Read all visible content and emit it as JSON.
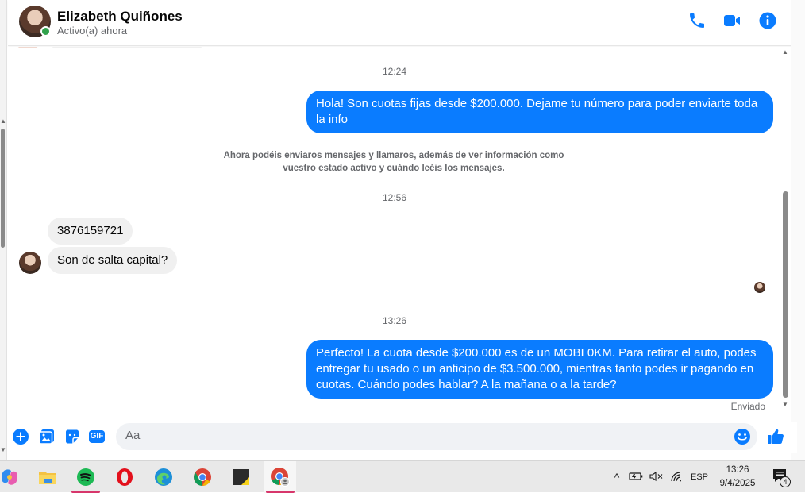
{
  "header": {
    "contact_name": "Elizabeth Quiñones",
    "status": "Activo(a) ahora",
    "actions": [
      "phone-icon",
      "video-icon",
      "info-icon"
    ],
    "accent_color": "#0a7cff"
  },
  "messages": {
    "time_1": "12:24",
    "out_1": "Hola! Son cuotas fijas desde $200.000. Dejame tu número para poder enviarte toda la info",
    "notice_line1": "Ahora podéis enviaros mensajes y llamaros, además de ver información como",
    "notice_line2": "vuestro estado activo y cuándo leéis los mensajes.",
    "time_2": "12:56",
    "in_1": "3876159721",
    "in_2": "Son de salta capital?",
    "time_3": "13:26",
    "out_2": "Perfecto! La cuota desde $200.000 es de un MOBI 0KM. Para retirar el auto, podes entregar tu usado o un anticipo de $3.500.000, mientras tanto podes ir pagando en cuotas. Cuándo podes hablar? A la mañana o a la tarde?",
    "delivery_status": "Enviado"
  },
  "composer": {
    "placeholder": "Aa",
    "gif_label": "GIF",
    "icons": [
      "plus-icon",
      "photo-icon",
      "sticker-icon",
      "gif-icon",
      "emoji-icon",
      "like-icon"
    ]
  },
  "taskbar": {
    "apps": [
      "copilot",
      "file-explorer",
      "spotify",
      "opera",
      "edge",
      "chrome",
      "sticky-notes",
      "chrome-profile"
    ],
    "language": "ESP",
    "time": "13:26",
    "date": "9/4/2025",
    "notification_count": "4"
  }
}
